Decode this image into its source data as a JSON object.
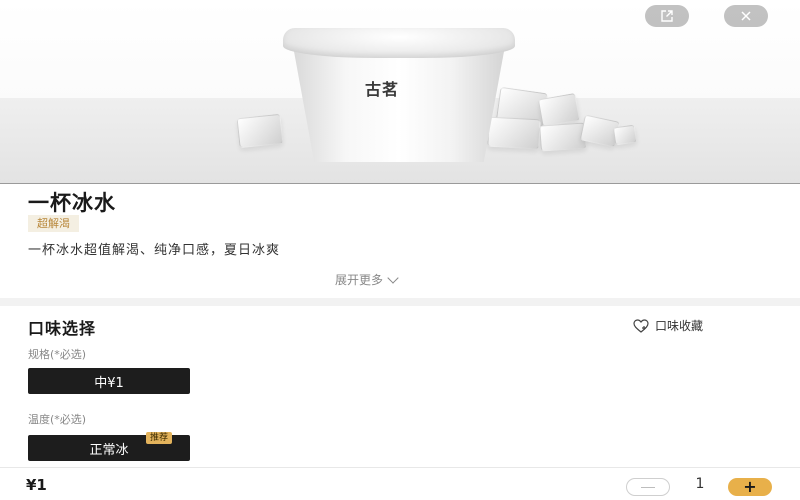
{
  "product": {
    "cup_logo": "古茗",
    "title": "一杯冰水",
    "tag": "超解渴",
    "description": "一杯冰水超值解渴、纯净口感，夏日冰爽",
    "expand_label": "展开更多"
  },
  "options": {
    "section_title": "口味选择",
    "favorite_label": "口味收藏",
    "spec": {
      "label": "规格(*必选)",
      "selected": "中¥1"
    },
    "temperature": {
      "label": "温度(*必选)",
      "selected": "正常冰",
      "badge": "推荐"
    }
  },
  "bottom_bar": {
    "price": "¥1",
    "quantity": "1",
    "plus_symbol": "+"
  },
  "icons": {
    "share": "share-icon",
    "close": "close-icon",
    "heart": "heart-icon",
    "chevron": "chevron-down-icon"
  },
  "colors": {
    "accent": "#e8b04a",
    "tag_bg": "#f4efe2",
    "tag_text": "#b8873a",
    "chip_bg": "#1d1d1d"
  }
}
